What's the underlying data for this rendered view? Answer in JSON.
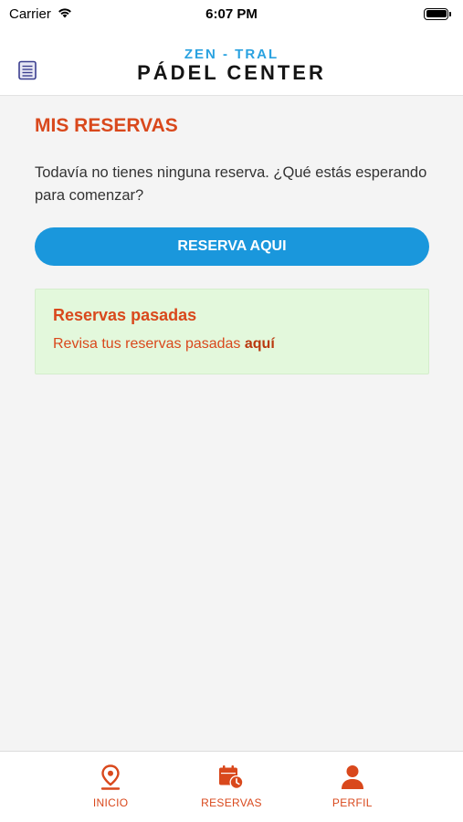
{
  "status_bar": {
    "carrier": "Carrier",
    "time": "6:07 PM"
  },
  "header": {
    "logo_top": "ZEN - TRAL",
    "logo_bottom": "PÁDEL CENTER"
  },
  "main": {
    "title": "MIS RESERVAS",
    "empty_message": "Todavía no tienes ninguna reserva. ¿Qué estás esperando para comenzar?",
    "reserve_button": "RESERVA AQUI",
    "past": {
      "title": "Reservas pasadas",
      "text": "Revisa tus reservas pasadas ",
      "link": "aquí"
    }
  },
  "tab_bar": {
    "items": [
      {
        "label": "INICIO",
        "icon": "location-pin-icon"
      },
      {
        "label": "RESERVAS",
        "icon": "calendar-clock-icon"
      },
      {
        "label": "PERFIL",
        "icon": "user-icon"
      }
    ]
  },
  "colors": {
    "accent": "#d9481c",
    "primary_button": "#1a97dc",
    "card_background": "#e3f8dc",
    "logo_blue": "#2aa2e0"
  }
}
